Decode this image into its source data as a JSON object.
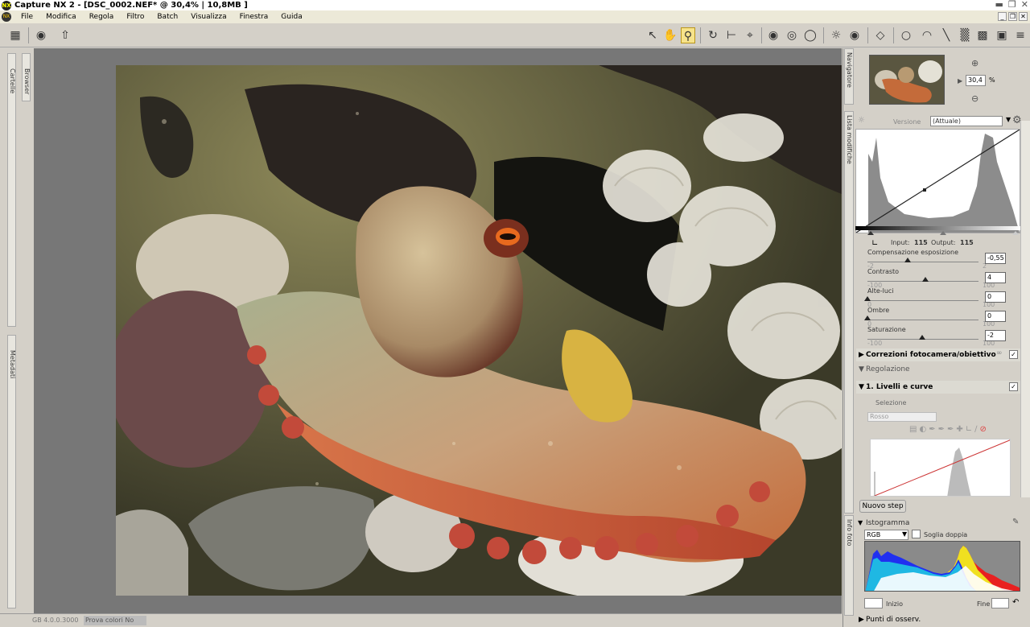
{
  "app": {
    "title": "Capture NX 2 - [DSC_0002.NEF* @ 30,4% | 10,8MB ]",
    "logo": "NX"
  },
  "menu": [
    "File",
    "Modifica",
    "Regola",
    "Filtro",
    "Batch",
    "Visualizza",
    "Finestra",
    "Guida"
  ],
  "left_tabs": {
    "folders": "Cartelle",
    "browser": "Browser",
    "metadata": "Metadati"
  },
  "status": {
    "version": "GB 4.0.0.3000",
    "proof": "Prova colori No"
  },
  "navigator": {
    "tab": "Navigatore",
    "zoom": "30,4",
    "unit": "%"
  },
  "edit_list": {
    "tab": "Lista modifiche",
    "version_label": "Versione",
    "version_value": "(Attuale)",
    "input_label": "Input:",
    "input_value": "115",
    "output_label": "Output:",
    "output_value": "115",
    "sliders": [
      {
        "label": "Compensazione esposizione",
        "min": "-2",
        "max": "2",
        "value": "-0,55",
        "pos": 0.36
      },
      {
        "label": "Contrasto",
        "min": "-100",
        "max": "100",
        "value": "4",
        "pos": 0.52
      },
      {
        "label": "Alte-luci",
        "min": "0",
        "max": "100",
        "value": "0",
        "pos": 0.0
      },
      {
        "label": "Ombre",
        "min": "0",
        "max": "100",
        "value": "0",
        "pos": 0.0
      },
      {
        "label": "Saturazione",
        "min": "-100",
        "max": "100",
        "value": "-2",
        "pos": 0.49
      }
    ],
    "camera_corrections": "Correzioni fotocamera/obiettivo",
    "adjust": "Regolazione",
    "step1": "1. Livelli e curve",
    "selection": "Selezione",
    "channel": "Rosso",
    "new_step": "Nuovo step"
  },
  "histogram": {
    "tab": "Info foto",
    "title": "Istogramma",
    "channel": "RGB",
    "double_threshold": "Soglia doppia",
    "start": "Inizio",
    "end": "Fine"
  },
  "watch_points": "Punti di osserv.",
  "colors": {
    "accent": "#f7e38a",
    "panel": "#d4d0c8",
    "canvas": "#777777"
  }
}
